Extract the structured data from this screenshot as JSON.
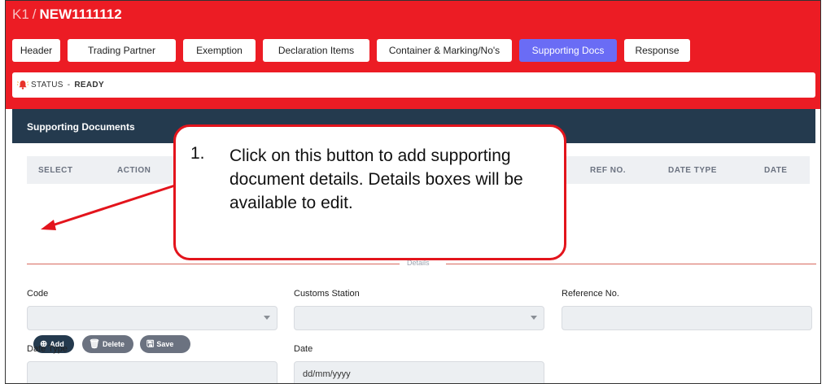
{
  "breadcrumb": {
    "prefix": "K1",
    "separator": "/",
    "doc_no": "NEW1111112"
  },
  "tabs": [
    {
      "label": "Header",
      "active": false
    },
    {
      "label": "Trading Partner",
      "active": false
    },
    {
      "label": "Exemption",
      "active": false
    },
    {
      "label": "Declaration Items",
      "active": false
    },
    {
      "label": "Container & Marking/No's",
      "active": false
    },
    {
      "label": "Supporting Docs",
      "active": true
    },
    {
      "label": "Response",
      "active": false
    }
  ],
  "status": {
    "label": "STATUS",
    "dash": "-",
    "value": "READY",
    "icon": "bell-icon"
  },
  "section": {
    "title": "Supporting Documents"
  },
  "table": {
    "columns": [
      "SELECT",
      "ACTION",
      "REF NO.",
      "DATE TYPE",
      "DATE"
    ]
  },
  "buttons": {
    "add": "Add",
    "delete": "Delete",
    "save": "Save"
  },
  "details": {
    "divider_label": "Details"
  },
  "form": {
    "code": {
      "label": "Code",
      "value": ""
    },
    "customs_station": {
      "label": "Customs Station",
      "value": ""
    },
    "reference_no": {
      "label": "Reference No.",
      "value": ""
    },
    "date_type": {
      "label": "Date Type",
      "value": ""
    },
    "date": {
      "label": "Date",
      "placeholder": "dd/mm/yyyy"
    }
  },
  "callout": {
    "number": "1.",
    "text": "Click on this button to add supporting document details. Details boxes will be available to edit."
  },
  "colors": {
    "topbar": "#ec1c24",
    "active_tab": "#6a6cf5",
    "card_header": "#243a4e",
    "callout_border": "#e3141c"
  }
}
